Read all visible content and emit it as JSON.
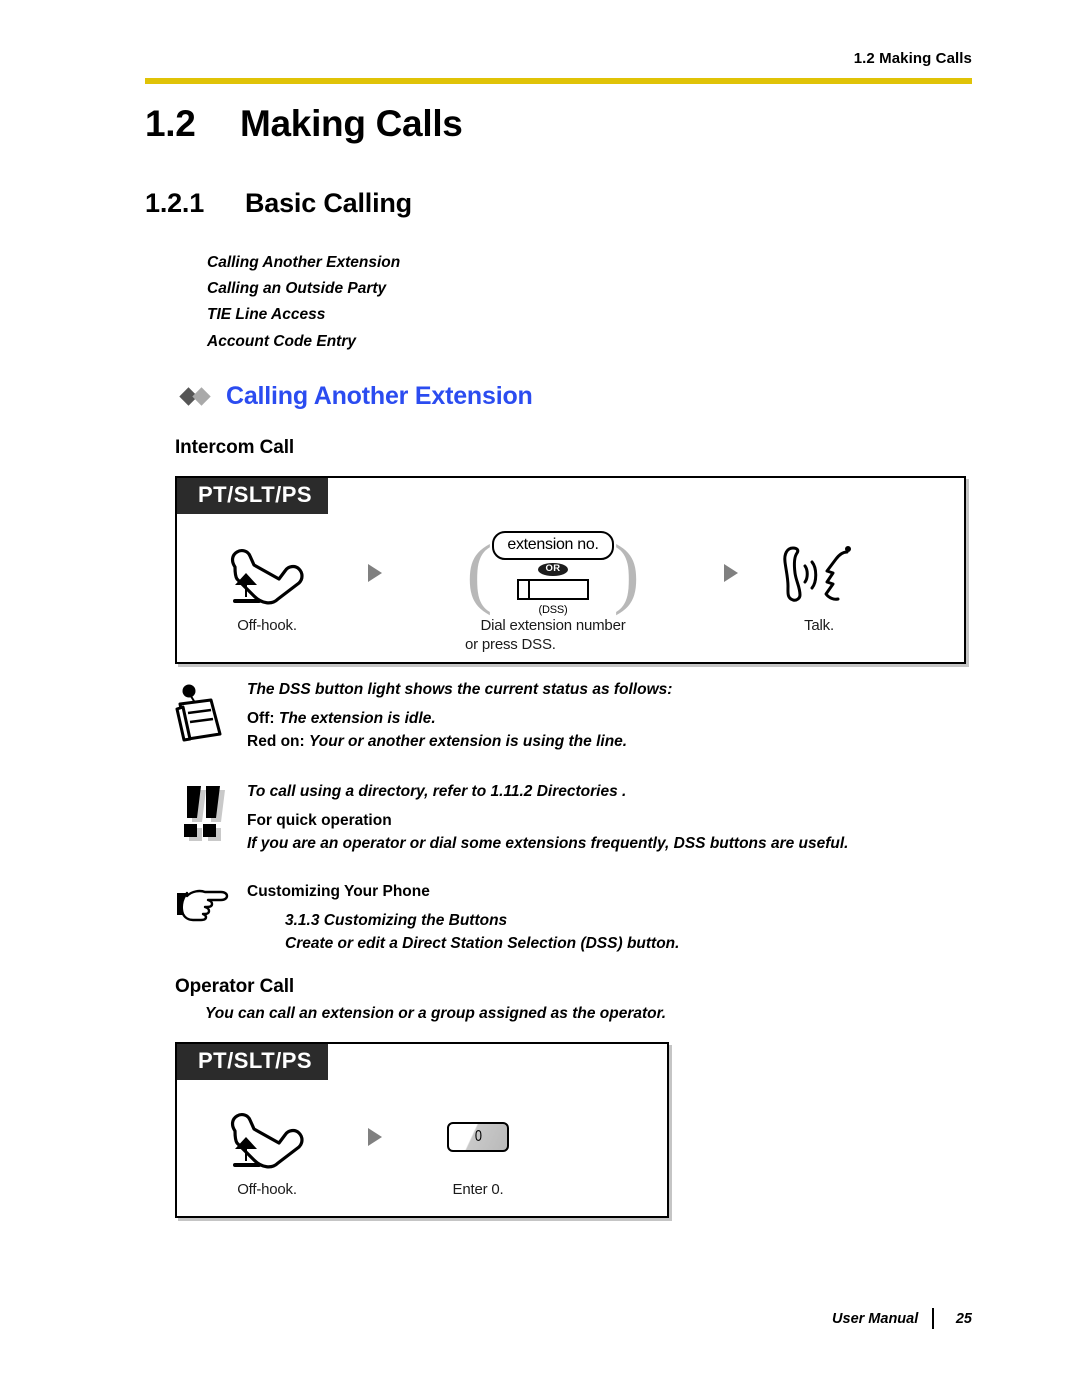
{
  "header": {
    "running_head": "1.2 Making Calls",
    "rule_color": "#e0c307"
  },
  "titles": {
    "h1_number": "1.2",
    "h1_text": "Making Calls",
    "h2_number": "1.2.1",
    "h2_text": "Basic Calling"
  },
  "summary_list": [
    "Calling Another Extension",
    "Calling an Outside Party",
    "TIE Line Access",
    "Account Code Entry"
  ],
  "feature": {
    "title": "Calling Another Extension",
    "title_color": "#2b4cf0",
    "diamond_dark": "#565656",
    "diamond_light": "#a9a9a9"
  },
  "sections": {
    "intercom_call": "Intercom Call",
    "operator_call": "Operator Call",
    "operator_call_desc": "You can call an extension or a group assigned as the operator."
  },
  "diagram_intercom": {
    "tag": "PT/SLT/PS",
    "steps": [
      {
        "caption_1": "Off-hook.",
        "caption_2": ""
      },
      {
        "keycap": "extension no.",
        "or": "OR",
        "dss": "(DSS)",
        "caption_1": "Dial extension number",
        "caption_2": "or press DSS."
      },
      {
        "caption_1": "Talk.",
        "caption_2": ""
      }
    ]
  },
  "diagram_operator": {
    "tag": "PT/SLT/PS",
    "steps": [
      {
        "caption_1": "Off-hook.",
        "caption_2": ""
      },
      {
        "key": "0",
        "caption_1": "Enter 0.",
        "caption_2": ""
      }
    ]
  },
  "note_dss": {
    "icon": "notepad-icon",
    "line1": "The DSS button light shows the current status as follows:",
    "line2_label": "Off:",
    "line2_text": "The extension is idle.",
    "line3_label": "Red on:",
    "line3_text": "Your or another extension is using the line."
  },
  "note_tip": {
    "icon": "double-exclamation-icon",
    "line1": "To call using a directory, refer to  1.11.2 Directories .",
    "line2": "For quick operation",
    "line3": "If you are an operator or dial some extensions frequently, DSS buttons are useful."
  },
  "note_customize": {
    "icon": "pointing-hand-icon",
    "line1": "Customizing Your Phone",
    "line2": "3.1.3 Customizing the Buttons",
    "line3": "Create or edit a Direct Station Selection (DSS) button."
  },
  "footer": {
    "manual_label": "User Manual",
    "page_number": "25"
  }
}
